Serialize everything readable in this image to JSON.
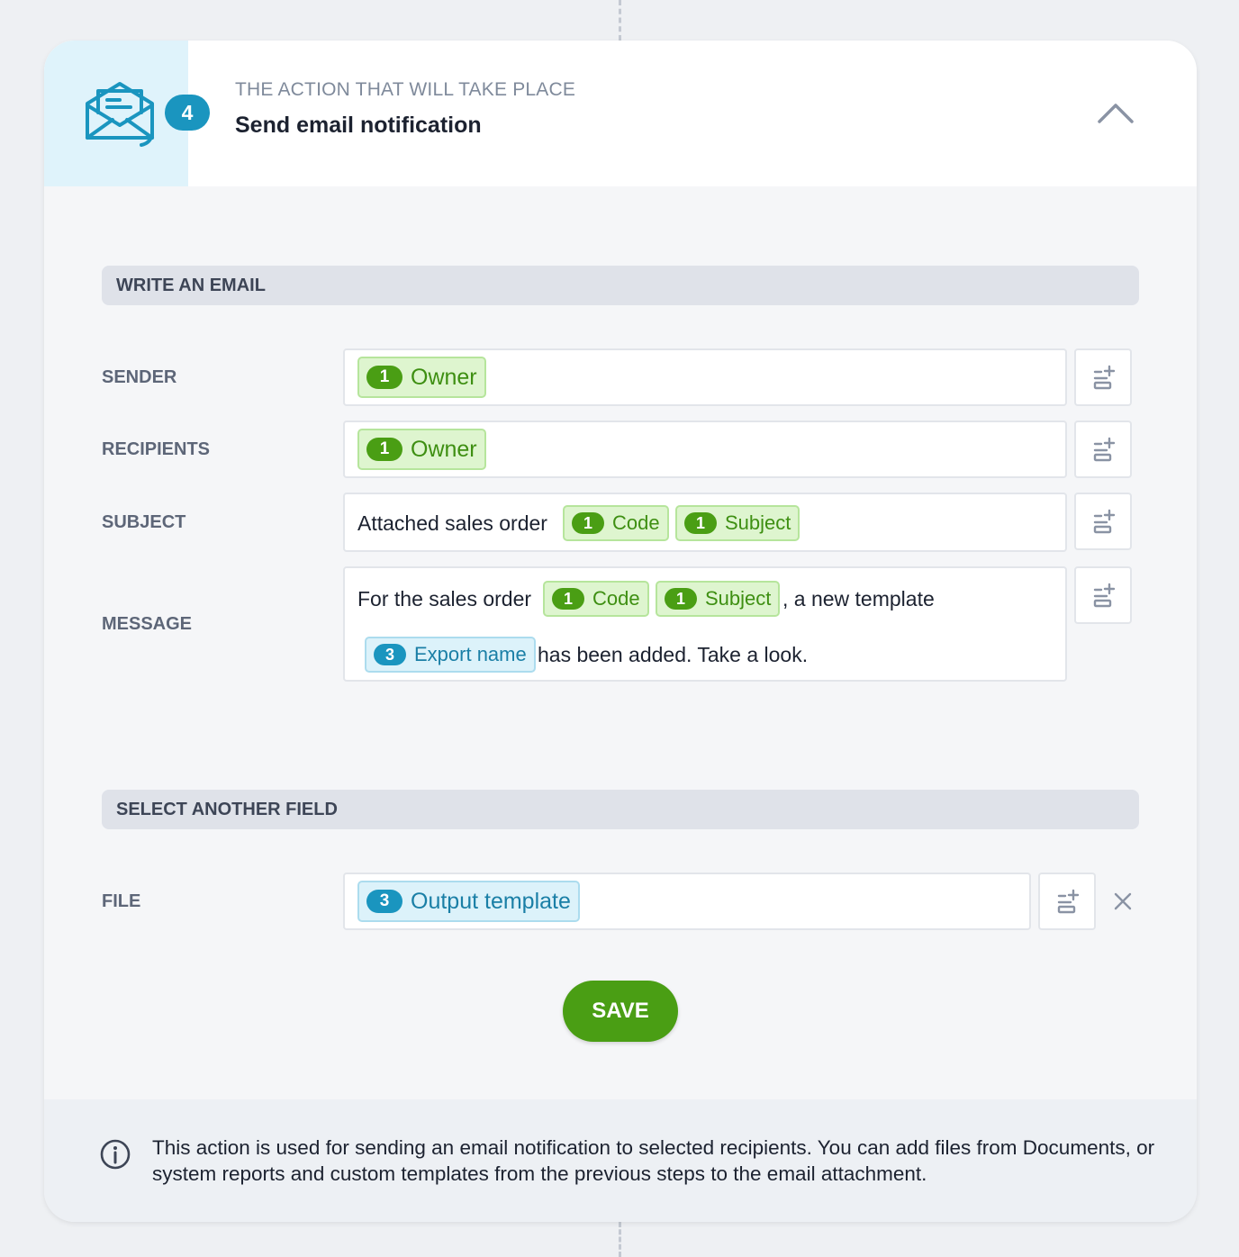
{
  "header": {
    "step_number": "4",
    "caption": "THE ACTION THAT WILL TAKE PLACE",
    "title": "Send email notification"
  },
  "sections": {
    "write_email": "WRITE AN EMAIL",
    "another_field": "SELECT ANOTHER FIELD"
  },
  "fields": {
    "sender": {
      "label": "SENDER",
      "chips": [
        {
          "num": "1",
          "text": "Owner"
        }
      ]
    },
    "recipients": {
      "label": "RECIPIENTS",
      "chips": [
        {
          "num": "1",
          "text": "Owner"
        }
      ]
    },
    "subject": {
      "label": "SUBJECT",
      "prefix": "Attached sales order",
      "chips": [
        {
          "num": "1",
          "text": "Code"
        },
        {
          "num": "1",
          "text": "Subject"
        }
      ]
    },
    "message": {
      "label": "MESSAGE",
      "prefix": "For the sales order",
      "chips": [
        {
          "num": "1",
          "text": "Code"
        },
        {
          "num": "1",
          "text": "Subject"
        },
        {
          "num": "3",
          "text": "Export name"
        }
      ],
      "middle": ", a new template",
      "suffix": "has been added. Take a look."
    },
    "file": {
      "label": "FILE",
      "chips": [
        {
          "num": "3",
          "text": "Output template"
        }
      ]
    }
  },
  "save_label": "SAVE",
  "info_text": "This action is used for sending an email notification to selected recipients. You can add files from Documents, or system reports and custom templates from the previous steps to the email attachment.",
  "colors": {
    "accent_blue": "#1a95bf",
    "accent_green": "#4a9e14",
    "chip_green_bg": "#def5cf",
    "chip_blue_bg": "#dcf2fa"
  },
  "icons": {
    "header": "open-envelope-icon",
    "collapse": "chevron-up-icon",
    "add_field": "add-field-icon",
    "remove": "close-icon",
    "info": "info-icon"
  }
}
